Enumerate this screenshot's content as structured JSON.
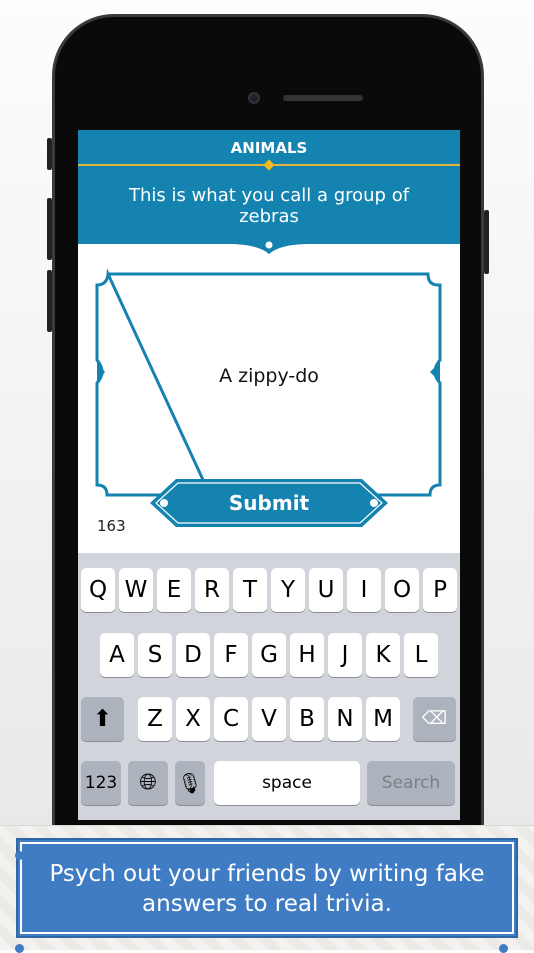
{
  "header": {
    "category": "ANIMALS",
    "question": "This is what you call a group of zebras"
  },
  "card": {
    "answer": "A zippy-do",
    "submit_label": "Submit",
    "char_count": "163"
  },
  "keyboard": {
    "row1": [
      "Q",
      "W",
      "E",
      "R",
      "T",
      "Y",
      "U",
      "I",
      "O",
      "P"
    ],
    "row2": [
      "A",
      "S",
      "D",
      "F",
      "G",
      "H",
      "J",
      "K",
      "L"
    ],
    "row3": [
      "Z",
      "X",
      "C",
      "V",
      "B",
      "N",
      "M"
    ],
    "numbers_label": "123",
    "space_label": "space",
    "search_label": "Search"
  },
  "banner": {
    "text": "Psych out your friends by writing fake answers to real trivia."
  },
  "colors": {
    "primary": "#1583b0",
    "accent": "#f4b820",
    "banner": "#3f7cc4"
  }
}
